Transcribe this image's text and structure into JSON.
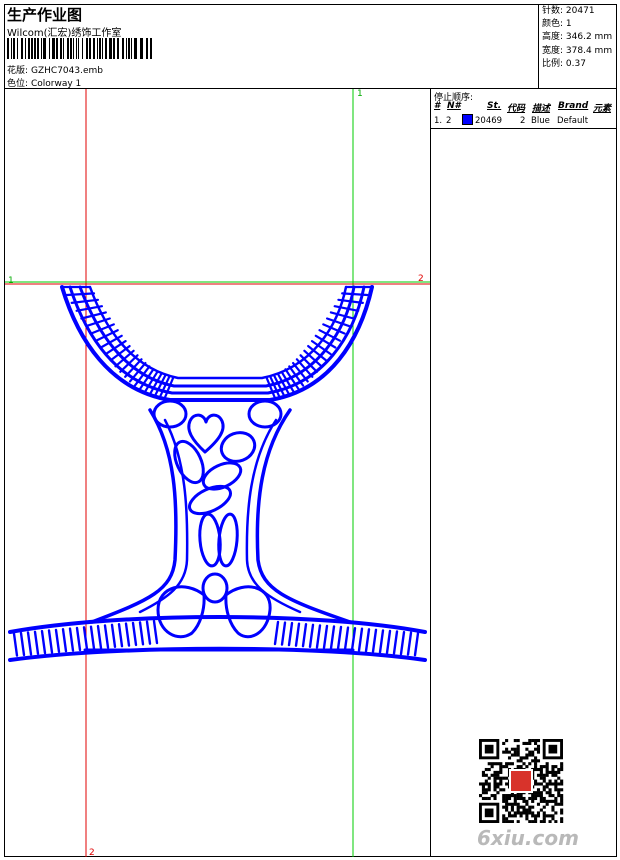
{
  "header": {
    "title": "生产作业图",
    "studio": "Wilcom(汇宏)绣饰工作室",
    "design_label": "花版:",
    "design_value": "GZHC7043.emb",
    "colorway_label": "色位:",
    "colorway_value": "Colorway 1"
  },
  "stats": [
    {
      "label": "针数:",
      "value": "20471"
    },
    {
      "label": "颜色:",
      "value": "1"
    },
    {
      "label": "高度:",
      "value": "346.2 mm"
    },
    {
      "label": "宽度:",
      "value": "378.4 mm"
    },
    {
      "label": "比例:",
      "value": "0.37"
    }
  ],
  "stop_sequence": {
    "title": "停止顺序:",
    "headers": [
      "#",
      "N#",
      "St.",
      "代码",
      "描述",
      "Brand",
      "元素"
    ],
    "rows": [
      {
        "index": "1.",
        "needle": "2",
        "color": "#0000ff",
        "stitches": "20469",
        "code": "2",
        "description": "Blue",
        "brand": "Default"
      }
    ]
  },
  "guides": {
    "v1_label": "1",
    "v2_label": "2",
    "h1_left_label": "1",
    "h2_right_label": "2"
  },
  "watermark": "6xiu.com",
  "colors": {
    "stitch": "#0000ff",
    "guide_red": "#e00000",
    "guide_green": "#00cc00"
  }
}
